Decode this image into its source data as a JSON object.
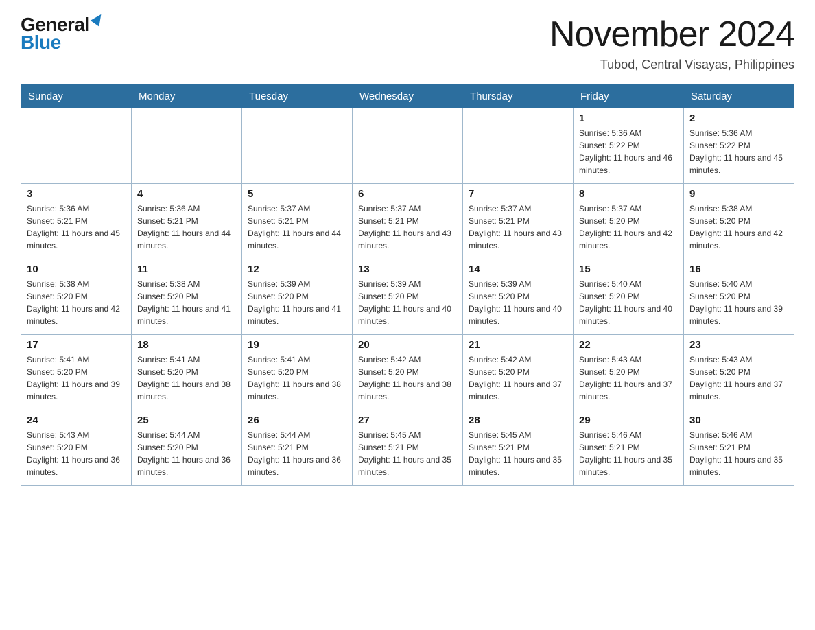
{
  "header": {
    "logo_general": "General",
    "logo_blue": "Blue",
    "month_title": "November 2024",
    "location": "Tubod, Central Visayas, Philippines"
  },
  "weekdays": [
    "Sunday",
    "Monday",
    "Tuesday",
    "Wednesday",
    "Thursday",
    "Friday",
    "Saturday"
  ],
  "weeks": [
    [
      {
        "day": "",
        "info": ""
      },
      {
        "day": "",
        "info": ""
      },
      {
        "day": "",
        "info": ""
      },
      {
        "day": "",
        "info": ""
      },
      {
        "day": "",
        "info": ""
      },
      {
        "day": "1",
        "info": "Sunrise: 5:36 AM\nSunset: 5:22 PM\nDaylight: 11 hours and 46 minutes."
      },
      {
        "day": "2",
        "info": "Sunrise: 5:36 AM\nSunset: 5:22 PM\nDaylight: 11 hours and 45 minutes."
      }
    ],
    [
      {
        "day": "3",
        "info": "Sunrise: 5:36 AM\nSunset: 5:21 PM\nDaylight: 11 hours and 45 minutes."
      },
      {
        "day": "4",
        "info": "Sunrise: 5:36 AM\nSunset: 5:21 PM\nDaylight: 11 hours and 44 minutes."
      },
      {
        "day": "5",
        "info": "Sunrise: 5:37 AM\nSunset: 5:21 PM\nDaylight: 11 hours and 44 minutes."
      },
      {
        "day": "6",
        "info": "Sunrise: 5:37 AM\nSunset: 5:21 PM\nDaylight: 11 hours and 43 minutes."
      },
      {
        "day": "7",
        "info": "Sunrise: 5:37 AM\nSunset: 5:21 PM\nDaylight: 11 hours and 43 minutes."
      },
      {
        "day": "8",
        "info": "Sunrise: 5:37 AM\nSunset: 5:20 PM\nDaylight: 11 hours and 42 minutes."
      },
      {
        "day": "9",
        "info": "Sunrise: 5:38 AM\nSunset: 5:20 PM\nDaylight: 11 hours and 42 minutes."
      }
    ],
    [
      {
        "day": "10",
        "info": "Sunrise: 5:38 AM\nSunset: 5:20 PM\nDaylight: 11 hours and 42 minutes."
      },
      {
        "day": "11",
        "info": "Sunrise: 5:38 AM\nSunset: 5:20 PM\nDaylight: 11 hours and 41 minutes."
      },
      {
        "day": "12",
        "info": "Sunrise: 5:39 AM\nSunset: 5:20 PM\nDaylight: 11 hours and 41 minutes."
      },
      {
        "day": "13",
        "info": "Sunrise: 5:39 AM\nSunset: 5:20 PM\nDaylight: 11 hours and 40 minutes."
      },
      {
        "day": "14",
        "info": "Sunrise: 5:39 AM\nSunset: 5:20 PM\nDaylight: 11 hours and 40 minutes."
      },
      {
        "day": "15",
        "info": "Sunrise: 5:40 AM\nSunset: 5:20 PM\nDaylight: 11 hours and 40 minutes."
      },
      {
        "day": "16",
        "info": "Sunrise: 5:40 AM\nSunset: 5:20 PM\nDaylight: 11 hours and 39 minutes."
      }
    ],
    [
      {
        "day": "17",
        "info": "Sunrise: 5:41 AM\nSunset: 5:20 PM\nDaylight: 11 hours and 39 minutes."
      },
      {
        "day": "18",
        "info": "Sunrise: 5:41 AM\nSunset: 5:20 PM\nDaylight: 11 hours and 38 minutes."
      },
      {
        "day": "19",
        "info": "Sunrise: 5:41 AM\nSunset: 5:20 PM\nDaylight: 11 hours and 38 minutes."
      },
      {
        "day": "20",
        "info": "Sunrise: 5:42 AM\nSunset: 5:20 PM\nDaylight: 11 hours and 38 minutes."
      },
      {
        "day": "21",
        "info": "Sunrise: 5:42 AM\nSunset: 5:20 PM\nDaylight: 11 hours and 37 minutes."
      },
      {
        "day": "22",
        "info": "Sunrise: 5:43 AM\nSunset: 5:20 PM\nDaylight: 11 hours and 37 minutes."
      },
      {
        "day": "23",
        "info": "Sunrise: 5:43 AM\nSunset: 5:20 PM\nDaylight: 11 hours and 37 minutes."
      }
    ],
    [
      {
        "day": "24",
        "info": "Sunrise: 5:43 AM\nSunset: 5:20 PM\nDaylight: 11 hours and 36 minutes."
      },
      {
        "day": "25",
        "info": "Sunrise: 5:44 AM\nSunset: 5:20 PM\nDaylight: 11 hours and 36 minutes."
      },
      {
        "day": "26",
        "info": "Sunrise: 5:44 AM\nSunset: 5:21 PM\nDaylight: 11 hours and 36 minutes."
      },
      {
        "day": "27",
        "info": "Sunrise: 5:45 AM\nSunset: 5:21 PM\nDaylight: 11 hours and 35 minutes."
      },
      {
        "day": "28",
        "info": "Sunrise: 5:45 AM\nSunset: 5:21 PM\nDaylight: 11 hours and 35 minutes."
      },
      {
        "day": "29",
        "info": "Sunrise: 5:46 AM\nSunset: 5:21 PM\nDaylight: 11 hours and 35 minutes."
      },
      {
        "day": "30",
        "info": "Sunrise: 5:46 AM\nSunset: 5:21 PM\nDaylight: 11 hours and 35 minutes."
      }
    ]
  ]
}
